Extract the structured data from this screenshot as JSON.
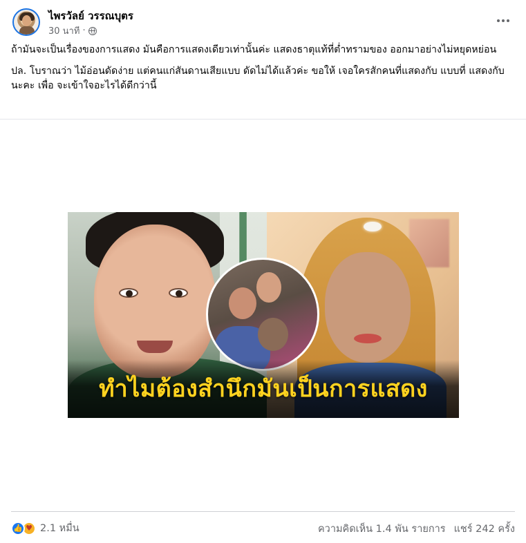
{
  "post": {
    "author": "ไพรวัลย์ วรรณบุตร",
    "time": "30 นาที",
    "separator": "·",
    "privacy_icon": "globe-icon",
    "paragraphs": [
      "ถ้ามันจะเป็นเรื่องของการแสดง มันคือการแสดงเดียวเท่านั้นค่ะ แสดงธาตุแท้ที่ต่ำทรามของ ออกมาอย่างไม่หยุดหย่อน",
      "ปล. โบราณว่า ไม้อ่อนดัดง่าย แต่คนแก่สันดานเสียแบบ ดัดไม่ได้แล้วค่ะ ขอให้ เจอใครสักคนที่แสดงกับ แบบที่ แสดงกับ นะคะ เพื่อ จะเข้าใจอะไรได้ดีกว่านี้"
    ]
  },
  "media": {
    "caption": "ทำไมต้องสำนึกมันเป็นการแสดง"
  },
  "footer": {
    "reaction_icons": [
      "like-icon",
      "care-icon"
    ],
    "reaction_count": "2.1 หมื่น",
    "comments": "ความคิดเห็น 1.4 พัน รายการ",
    "shares": "แชร์ 242 ครั้ง"
  },
  "colors": {
    "accent": "#1877f2",
    "caption": "#ffd21f",
    "meta_text": "#65676b"
  }
}
